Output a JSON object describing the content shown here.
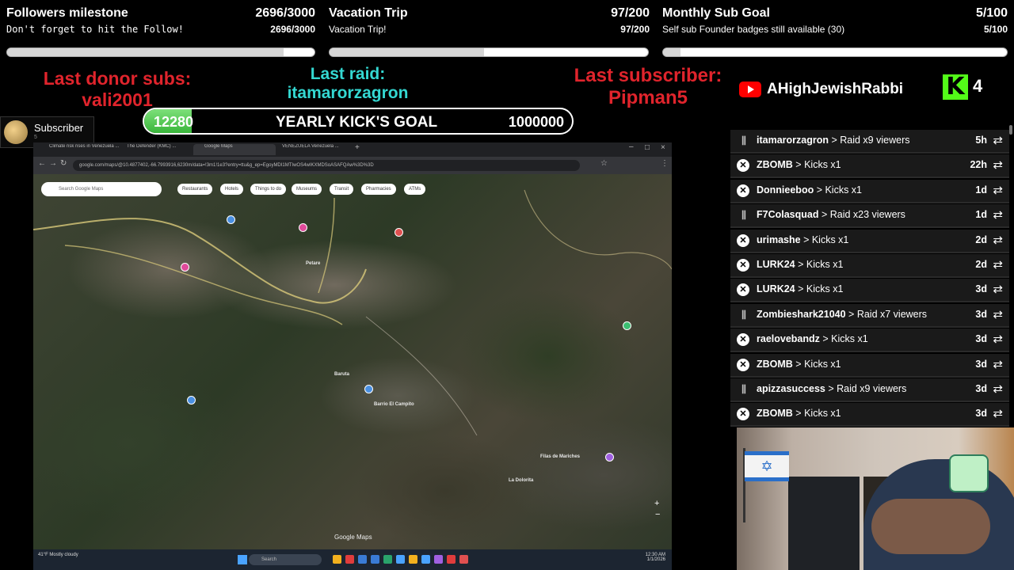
{
  "goals": [
    {
      "title": "Followers milestone",
      "count": "2696/3000",
      "subtitle": "Don't forget to hit the Follow!",
      "count2": "2696/3000",
      "progress": 0.8987
    },
    {
      "title": "Vacation Trip",
      "count": "97/200",
      "subtitle": "Vacation Trip!",
      "count2": "97/200",
      "progress": 0.485
    },
    {
      "title": "Monthly Sub Goal",
      "count": "5/100",
      "subtitle": "Self sub Founder badges still available (30)",
      "count2": "5/100",
      "progress": 0.05
    }
  ],
  "last_donor": {
    "label": "Last donor subs:",
    "name": "vali2001"
  },
  "last_raid": {
    "label": "Last raid:",
    "name": "itamarorzagron"
  },
  "last_subscriber": {
    "label": "Last subscriber:",
    "name": "Pipman5"
  },
  "yearly_goal": {
    "current": "12280",
    "label": "YEARLY KICK'S GOAL",
    "total": "1000000",
    "progress": 0.01228
  },
  "subscriber_card": {
    "label": "Subscriber",
    "count": "5"
  },
  "youtube": {
    "channel": "AHighJewishRabbi"
  },
  "kick": {
    "logo": "K",
    "count": "4"
  },
  "events": [
    {
      "type": "raid",
      "name": "itamarorzagron",
      "action": "Raid x9 viewers",
      "time": "5h"
    },
    {
      "type": "kick",
      "name": "ZBOMB",
      "action": "Kicks x1",
      "time": "22h"
    },
    {
      "type": "kick",
      "name": "Donnieeboo",
      "action": "Kicks x1",
      "time": "1d"
    },
    {
      "type": "raid",
      "name": "F7Colasquad",
      "action": "Raid x23 viewers",
      "time": "1d"
    },
    {
      "type": "kick",
      "name": "urimashe",
      "action": "Kicks x1",
      "time": "2d"
    },
    {
      "type": "kick",
      "name": "LURK24",
      "action": "Kicks x1",
      "time": "2d"
    },
    {
      "type": "kick",
      "name": "LURK24",
      "action": "Kicks x1",
      "time": "3d"
    },
    {
      "type": "raid",
      "name": "Zombieshark21040",
      "action": "Raid x7 viewers",
      "time": "3d"
    },
    {
      "type": "kick",
      "name": "raelovebandz",
      "action": "Kicks x1",
      "time": "3d"
    },
    {
      "type": "kick",
      "name": "ZBOMB",
      "action": "Kicks x1",
      "time": "3d"
    },
    {
      "type": "raid",
      "name": "apizzasuccess",
      "action": "Raid x9 viewers",
      "time": "3d"
    },
    {
      "type": "kick",
      "name": "ZBOMB",
      "action": "Kicks x1",
      "time": "3d"
    }
  ],
  "browser": {
    "tabs": [
      "Climate risk rises in Venezuela ...",
      "The Defender (KMC) ...",
      "Google Maps",
      "VENEZUELA Venezuela ..."
    ],
    "url": "google.com/maps/@10.4877402,-66.7993916,6230m/data=!3m1!1e3?entry=ttu&g_ep=EgoyMDI1MTIwOS4wIKXMDSoASAFQAw%3D%3D",
    "map": {
      "search_placeholder": "Search Google Maps",
      "chips": [
        "Restaurants",
        "Hotels",
        "Things to do",
        "Museums",
        "Transit",
        "Pharmacies",
        "ATMs"
      ],
      "attribution": "Google Maps",
      "place_labels": [
        "La Dolorita",
        "Petare",
        "Filas de Mariches",
        "Barrio El Campito",
        "Baruta"
      ]
    }
  },
  "taskbar": {
    "weather": "41°F Mostly cloudy",
    "search": "Search",
    "time": "12:30 AM",
    "date": "1/1/2026"
  },
  "colors": {
    "donor": "#e0242c",
    "raid": "#34d8d2",
    "kick_green": "#53fc18",
    "youtube_red": "#ff0000"
  }
}
